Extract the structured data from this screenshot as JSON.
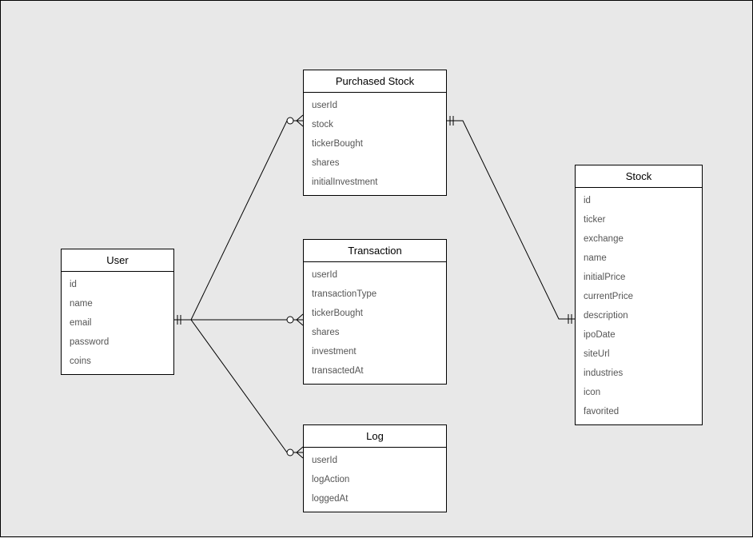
{
  "entities": {
    "user": {
      "title": "User",
      "attrs": [
        "id",
        "name",
        "email",
        "password",
        "coins"
      ]
    },
    "purchasedStock": {
      "title": "Purchased Stock",
      "attrs": [
        "userId",
        "stock",
        "tickerBought",
        "shares",
        "initialInvestment"
      ]
    },
    "transaction": {
      "title": "Transaction",
      "attrs": [
        "userId",
        "transactionType",
        "tickerBought",
        "shares",
        "investment",
        "transactedAt"
      ]
    },
    "log": {
      "title": "Log",
      "attrs": [
        "userId",
        "logAction",
        "loggedAt"
      ]
    },
    "stock": {
      "title": "Stock",
      "attrs": [
        "id",
        "ticker",
        "exchange",
        "name",
        "initialPrice",
        "currentPrice",
        "description",
        "ipoDate",
        "siteUrl",
        "industries",
        "icon",
        "favorited"
      ]
    }
  }
}
